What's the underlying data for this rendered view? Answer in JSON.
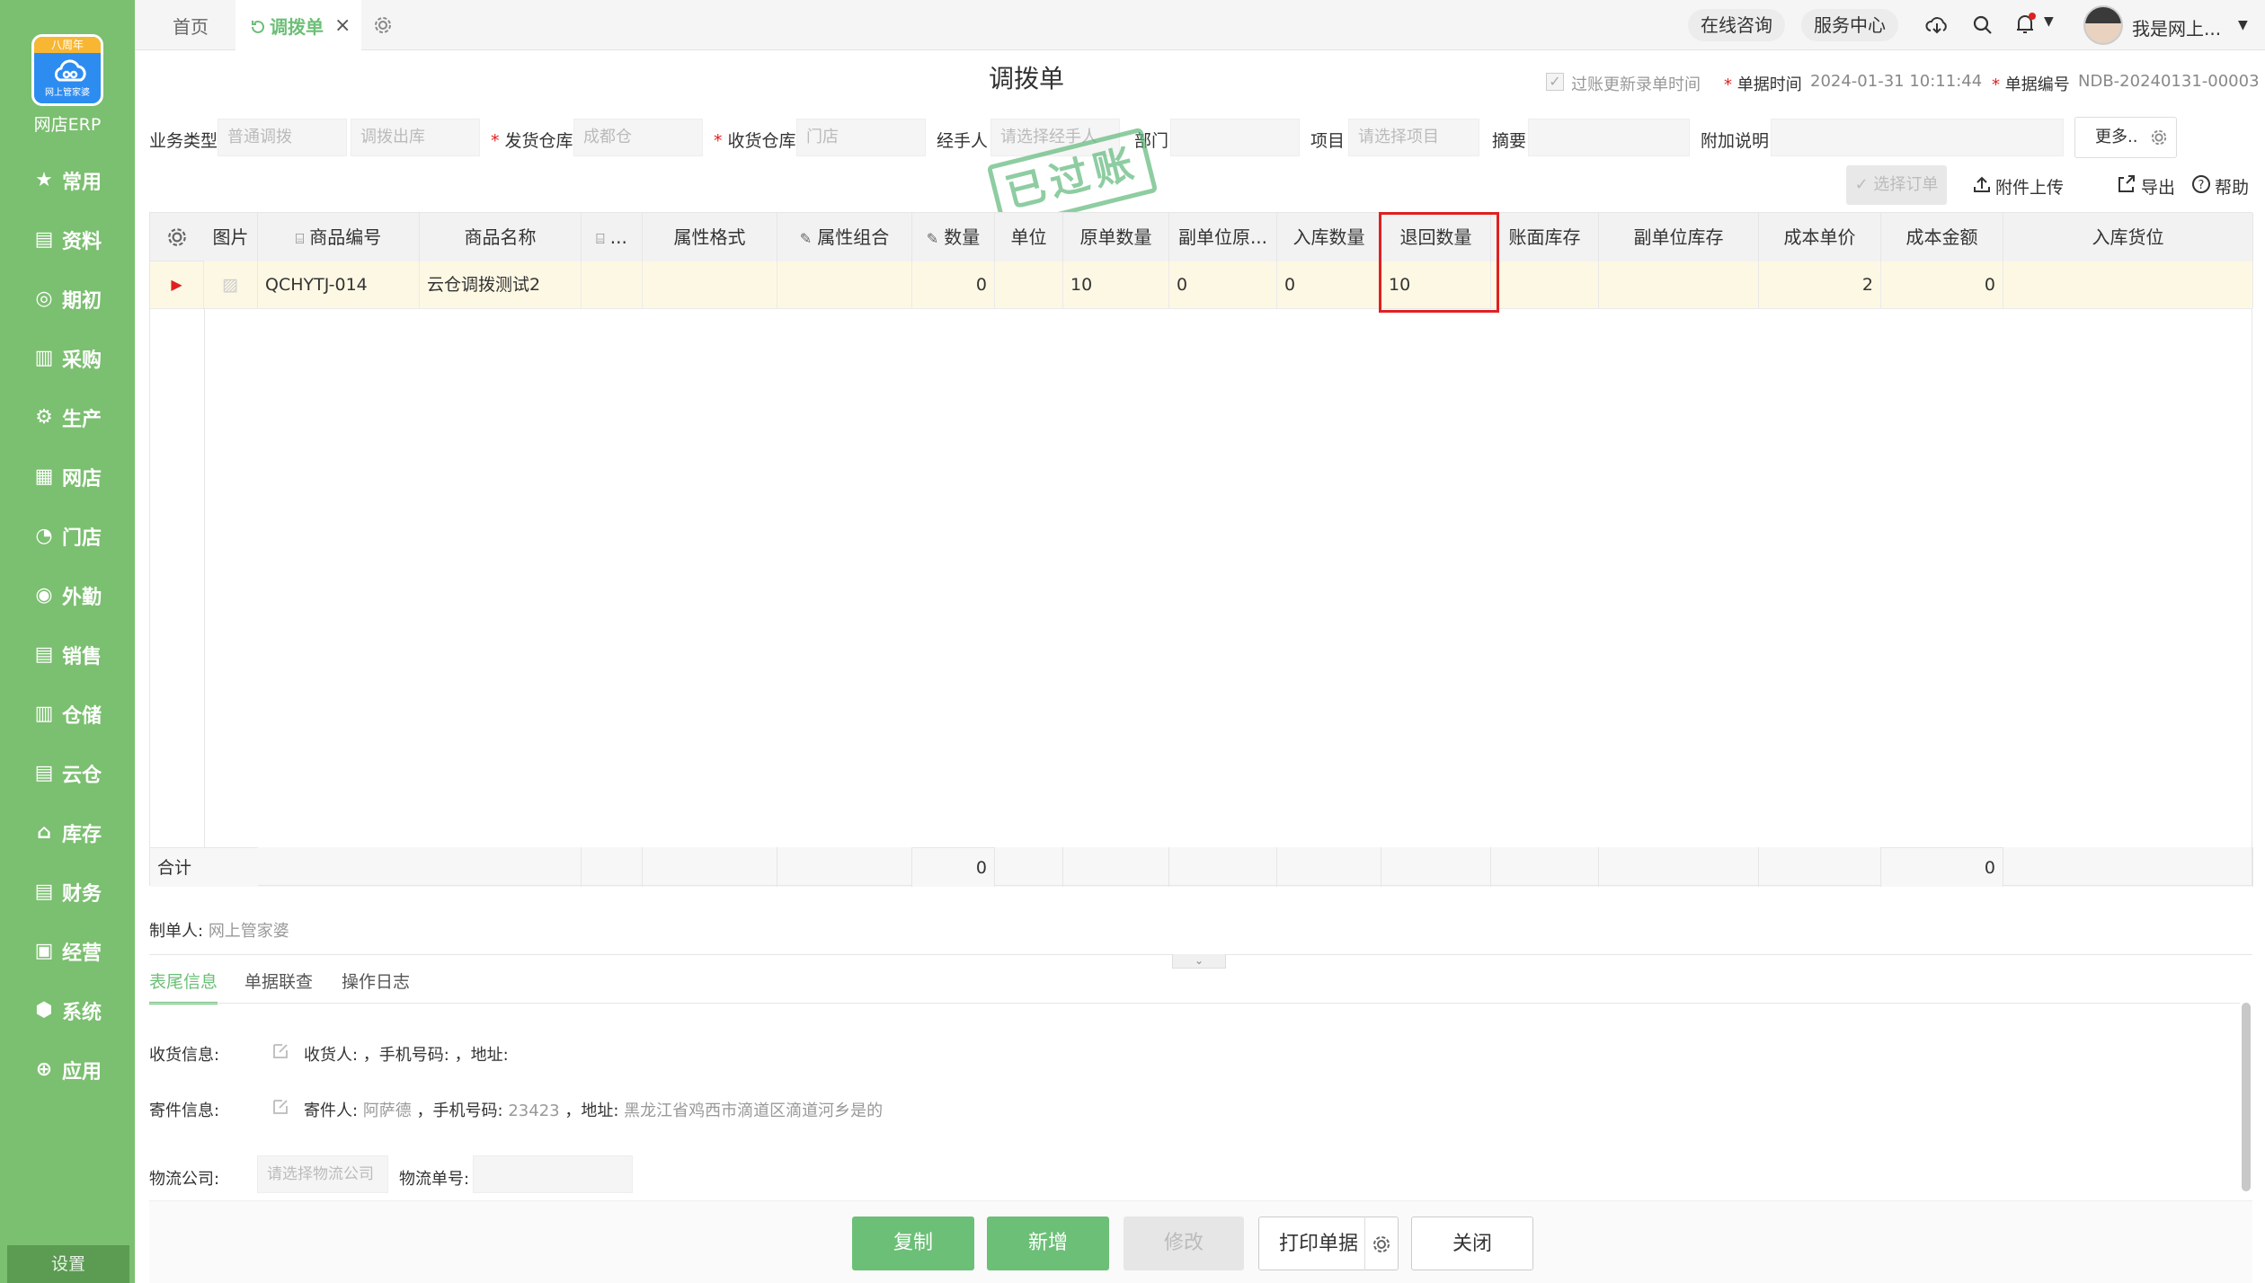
{
  "sidebar": {
    "logo_top": "八周年",
    "logo_sub": "网上管家婆",
    "app_name": "网店ERP",
    "items": [
      {
        "label": "常用",
        "icon": "star-icon"
      },
      {
        "label": "资料",
        "icon": "document-icon"
      },
      {
        "label": "期初",
        "icon": "target-icon"
      },
      {
        "label": "采购",
        "icon": "purchase-icon"
      },
      {
        "label": "生产",
        "icon": "production-icon"
      },
      {
        "label": "网店",
        "icon": "store-icon"
      },
      {
        "label": "门店",
        "icon": "pie-icon"
      },
      {
        "label": "外勤",
        "icon": "field-icon"
      },
      {
        "label": "销售",
        "icon": "sales-icon"
      },
      {
        "label": "仓储",
        "icon": "warehouse-icon"
      },
      {
        "label": "云仓",
        "icon": "cloud-warehouse-icon"
      },
      {
        "label": "库存",
        "icon": "inventory-icon"
      },
      {
        "label": "财务",
        "icon": "finance-icon"
      },
      {
        "label": "经营",
        "icon": "business-icon"
      },
      {
        "label": "系统",
        "icon": "system-icon"
      },
      {
        "label": "应用",
        "icon": "apps-icon"
      }
    ],
    "settings": "设置"
  },
  "topbar": {
    "home_tab": "首页",
    "active_tab": "调拨单",
    "consult": "在线咨询",
    "service": "服务中心",
    "user": "我是网上..."
  },
  "doc": {
    "title": "调拨单",
    "update_time_check": "过账更新录单时间",
    "date_label": "单据时间",
    "date_value": "2024-01-31 10:11:44",
    "no_label": "单据编号",
    "no_value": "NDB-20240131-00003",
    "stamp": "已过账"
  },
  "form": {
    "biz_type_label": "业务类型",
    "biz_type": "普通调拨",
    "biz_sub": "调拨出库",
    "send_wh_label": "发货仓库",
    "send_wh": "成都仓",
    "recv_wh_label": "收货仓库",
    "recv_wh": "门店",
    "handler_label": "经手人",
    "handler_ph": "请选择经手人",
    "dept_label": "部门",
    "project_label": "项目",
    "project_ph": "请选择项目",
    "summary_label": "摘要",
    "note_label": "附加说明",
    "more": "更多..",
    "select_order": "选择订单",
    "attach": "附件上传",
    "export": "导出",
    "help": "帮助"
  },
  "table": {
    "headers": [
      "图片",
      "商品编号",
      "商品名称",
      "...",
      "属性格式",
      "属性组合",
      "数量",
      "单位",
      "原单数量",
      "副单位原...",
      "入库数量",
      "退回数量",
      "账面库存",
      "副单位库存",
      "成本单价",
      "成本金额",
      "入库货位"
    ],
    "row": {
      "code": "QCHYTJ-014",
      "name": "云仓调拨测试2",
      "qty": "0",
      "orig_qty": "10",
      "sub_orig": "0",
      "in_qty": "0",
      "return_qty": "10",
      "unit_cost": "2",
      "cost_amount": "0"
    },
    "sum_label": "合计",
    "sum_qty": "0",
    "sum_amount": "0"
  },
  "footer": {
    "maker_label": "制单人:",
    "maker": "网上管家婆",
    "tabs": [
      "表尾信息",
      "单据联查",
      "操作日志"
    ],
    "recv_label": "收货信息:",
    "recv_text": "收货人: ，手机号码: ，地址:",
    "send_label": "寄件信息:",
    "send_person_label": "寄件人:",
    "send_person": "阿萨德",
    "send_phone_label": "，手机号码:",
    "send_phone": "23423",
    "send_addr_label": "，地址:",
    "send_addr": "黑龙江省鸡西市滴道区滴道河乡是的",
    "logistics_label": "物流公司:",
    "logistics_ph": "请选择物流公司",
    "tracking_label": "物流单号:"
  },
  "buttons": {
    "copy": "复制",
    "new": "新增",
    "edit": "修改",
    "print": "打印单据",
    "close": "关闭"
  },
  "colors": {
    "sidebar": "#7bbf70",
    "primary_button": "#6cbf77",
    "highlight_box": "#e02020",
    "row_bg": "#fdf8e4",
    "stamp": "#5fb87a"
  }
}
